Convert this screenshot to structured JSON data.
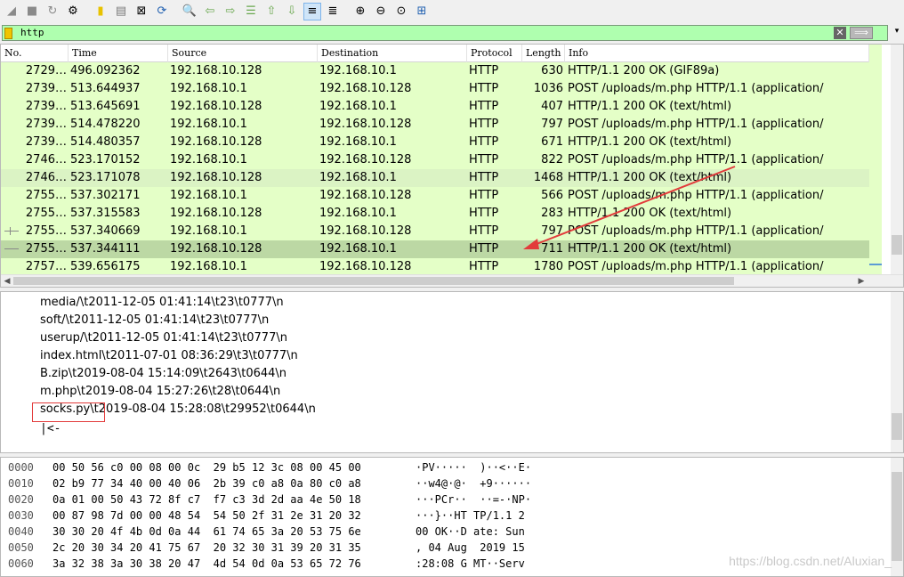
{
  "toolbar": {
    "icons": [
      "shark-fin-start-icon",
      "stop-icon",
      "restart-icon",
      "capture-options-icon",
      "open-file-icon",
      "save-file-icon",
      "close-file-icon",
      "reload-icon",
      "find-packet-icon",
      "go-back-icon",
      "go-forward-icon",
      "go-to-packet-icon",
      "go-first-icon",
      "go-last-icon",
      "autoscroll-icon",
      "colorize-icon",
      "zoom-in-icon",
      "zoom-out-icon",
      "normal-size-icon",
      "resize-columns-icon"
    ]
  },
  "filter": {
    "value": "http",
    "clear_glyph": "✕",
    "apply_glyph": "⟹",
    "dropdown_glyph": "▾"
  },
  "packet_list": {
    "columns": [
      "No.",
      "Time",
      "Source",
      "Destination",
      "Protocol",
      "Length",
      "Info"
    ],
    "rows": [
      {
        "no": "2729…",
        "time": "496.092362",
        "src": "192.168.10.128",
        "dst": "192.168.10.1",
        "proto": "HTTP",
        "len": "630",
        "info": "HTTP/1.1 200 OK  (GIF89a)"
      },
      {
        "no": "2739…",
        "time": "513.644937",
        "src": "192.168.10.1",
        "dst": "192.168.10.128",
        "proto": "HTTP",
        "len": "1036",
        "info": "POST /uploads/m.php HTTP/1.1  (application/"
      },
      {
        "no": "2739…",
        "time": "513.645691",
        "src": "192.168.10.128",
        "dst": "192.168.10.1",
        "proto": "HTTP",
        "len": "407",
        "info": "HTTP/1.1 200 OK  (text/html)"
      },
      {
        "no": "2739…",
        "time": "514.478220",
        "src": "192.168.10.1",
        "dst": "192.168.10.128",
        "proto": "HTTP",
        "len": "797",
        "info": "POST /uploads/m.php HTTP/1.1  (application/"
      },
      {
        "no": "2739…",
        "time": "514.480357",
        "src": "192.168.10.128",
        "dst": "192.168.10.1",
        "proto": "HTTP",
        "len": "671",
        "info": "HTTP/1.1 200 OK  (text/html)"
      },
      {
        "no": "2746…",
        "time": "523.170152",
        "src": "192.168.10.1",
        "dst": "192.168.10.128",
        "proto": "HTTP",
        "len": "822",
        "info": "POST /uploads/m.php HTTP/1.1  (application/"
      },
      {
        "no": "2746…",
        "time": "523.171078",
        "src": "192.168.10.128",
        "dst": "192.168.10.1",
        "proto": "HTTP",
        "len": "1468",
        "info": "HTTP/1.1 200 OK  (text/html)"
      },
      {
        "no": "2755…",
        "time": "537.302171",
        "src": "192.168.10.1",
        "dst": "192.168.10.128",
        "proto": "HTTP",
        "len": "566",
        "info": "POST /uploads/m.php HTTP/1.1  (application/"
      },
      {
        "no": "2755…",
        "time": "537.315583",
        "src": "192.168.10.128",
        "dst": "192.168.10.1",
        "proto": "HTTP",
        "len": "283",
        "info": "HTTP/1.1 200 OK  (text/html)"
      },
      {
        "no": "2755…",
        "time": "537.340669",
        "src": "192.168.10.1",
        "dst": "192.168.10.128",
        "proto": "HTTP",
        "len": "797",
        "info": "POST /uploads/m.php HTTP/1.1  (application/"
      },
      {
        "no": "2755…",
        "time": "537.344111",
        "src": "192.168.10.128",
        "dst": "192.168.10.1",
        "proto": "HTTP",
        "len": "711",
        "info": "HTTP/1.1 200 OK  (text/html)"
      },
      {
        "no": "2757…",
        "time": "539.656175",
        "src": "192.168.10.1",
        "dst": "192.168.10.128",
        "proto": "HTTP",
        "len": "1780",
        "info": "POST /uploads/m.php HTTP/1.1  (application/"
      }
    ]
  },
  "details": {
    "lines": [
      "media/\\t2011-12-05 01:41:14\\t23\\t0777\\n",
      "soft/\\t2011-12-05 01:41:14\\t23\\t0777\\n",
      "userup/\\t2011-12-05 01:41:14\\t23\\t0777\\n",
      "index.html\\t2011-07-01 08:36:29\\t3\\t0777\\n",
      "B.zip\\t2019-08-04 15:14:09\\t2643\\t0644\\n",
      "m.php\\t2019-08-04 15:27:26\\t28\\t0644\\n",
      "socks.py\\t2019-08-04 15:28:08\\t29952\\t0644\\n"
    ],
    "cursor_text": "|<-"
  },
  "hex": {
    "rows": [
      {
        "offset": "0000",
        "bytes": "00 50 56 c0 00 08 00 0c  29 b5 12 3c 08 00 45 00",
        "ascii": "·PV·····  )··<··E·"
      },
      {
        "offset": "0010",
        "bytes": "02 b9 77 34 40 00 40 06  2b 39 c0 a8 0a 80 c0 a8",
        "ascii": "··w4@·@·  +9······"
      },
      {
        "offset": "0020",
        "bytes": "0a 01 00 50 43 72 8f c7  f7 c3 3d 2d aa 4e 50 18",
        "ascii": "···PCr··  ··=-·NP·"
      },
      {
        "offset": "0030",
        "bytes": "00 87 98 7d 00 00 48 54  54 50 2f 31 2e 31 20 32",
        "ascii": "···}··HT TP/1.1 2"
      },
      {
        "offset": "0040",
        "bytes": "30 30 20 4f 4b 0d 0a 44  61 74 65 3a 20 53 75 6e",
        "ascii": "00 OK··D ate: Sun"
      },
      {
        "offset": "0050",
        "bytes": "2c 20 30 34 20 41 75 67  20 32 30 31 39 20 31 35",
        "ascii": ", 04 Aug  2019 15"
      },
      {
        "offset": "0060",
        "bytes": "3a 32 38 3a 30 38 20 47  4d 54 0d 0a 53 65 72 76",
        "ascii": ":28:08 G MT··Serv"
      }
    ]
  },
  "watermark": "https://blog.csdn.net/Aluxian_",
  "colors": {
    "row_bg": "#e4ffc7",
    "selected_row_bg": "#c7dfae",
    "filter_bg": "#afffaf",
    "annotation_red": "#e23b3b"
  }
}
